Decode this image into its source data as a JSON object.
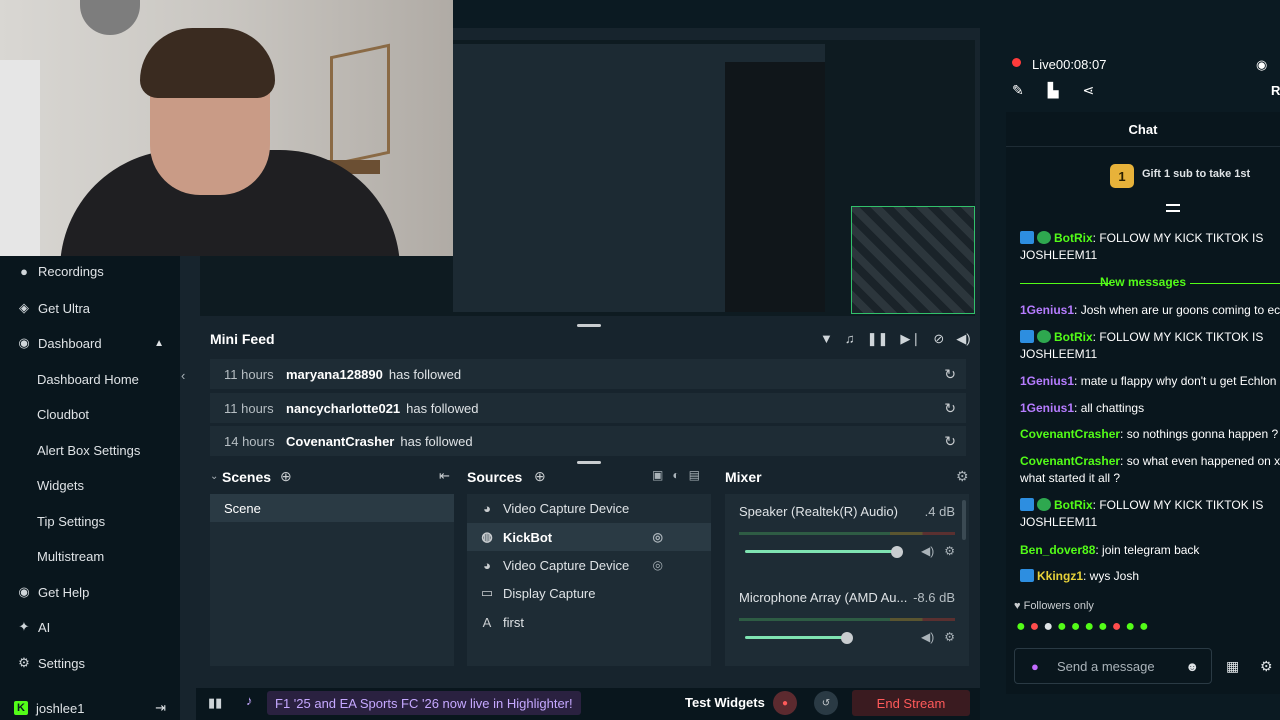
{
  "live": {
    "label": "Live",
    "timer": "00:08:07",
    "viewers_initial": "R"
  },
  "sidebar": {
    "items": [
      {
        "label": "Recordings",
        "icon": "recordings-icon",
        "glyph": "●"
      },
      {
        "label": "Get Ultra",
        "icon": "ultra-icon",
        "glyph": "◈"
      },
      {
        "label": "Dashboard",
        "icon": "dashboard-icon",
        "glyph": "◉"
      },
      {
        "label": "Dashboard Home"
      },
      {
        "label": "Cloudbot"
      },
      {
        "label": "Alert Box Settings"
      },
      {
        "label": "Widgets"
      },
      {
        "label": "Tip Settings"
      },
      {
        "label": "Multistream"
      },
      {
        "label": "Get Help",
        "icon": "help-icon",
        "glyph": "◉"
      },
      {
        "label": "AI",
        "icon": "ai-icon",
        "glyph": "✦"
      },
      {
        "label": "Settings",
        "icon": "gear-icon",
        "glyph": "⚙"
      }
    ],
    "user": "joshlee1"
  },
  "minifeed": {
    "title": "Mini Feed",
    "rows": [
      {
        "time": "11 hours",
        "name": "maryana128890",
        "action": "has followed"
      },
      {
        "time": "11 hours",
        "name": "nancycharlotte021",
        "action": "has followed"
      },
      {
        "time": "14 hours",
        "name": "CovenantCrasher",
        "action": "has followed"
      }
    ]
  },
  "scenes": {
    "title": "Scenes",
    "items": [
      "Scene"
    ]
  },
  "sources": {
    "title": "Sources",
    "items": [
      {
        "label": "Video Capture Device",
        "icon": "camera-icon",
        "glyph": "◕"
      },
      {
        "label": "KickBot",
        "icon": "globe-icon",
        "glyph": "◍"
      },
      {
        "label": "Video Capture Device",
        "icon": "camera-icon",
        "glyph": "◕"
      },
      {
        "label": "Display Capture",
        "icon": "monitor-icon",
        "glyph": "▭"
      },
      {
        "label": "first",
        "icon": "text-icon",
        "glyph": "A"
      }
    ]
  },
  "mixer": {
    "title": "Mixer",
    "channels": [
      {
        "name": "Speaker (Realtek(R) Audio)",
        "db": ".4 dB",
        "level": 0.95
      },
      {
        "name": "Microphone Array (AMD Au...",
        "db": "-8.6 dB",
        "level": 0.64
      }
    ]
  },
  "bottom": {
    "promo": "F1 '25 and EA Sports FC '26 now live in Highlighter!",
    "test_widgets": "Test Widgets",
    "end_stream": "End Stream"
  },
  "chat": {
    "title": "Chat",
    "gift_rank": "1",
    "gift_text": "Gift 1 sub to take 1st",
    "new_messages": "New messages",
    "messages": [
      {
        "user": "BotRix",
        "color": "#53fc18",
        "text": ": FOLLOW MY KICK TIKTOK IS JOSHLEEM11"
      },
      {
        "user": "1Genius1",
        "color": "#b67cff",
        "text": ": Josh when are ur goons coming to ec"
      },
      {
        "user": "BotRix",
        "color": "#53fc18",
        "text": ": FOLLOW MY KICK TIKTOK IS JOSHLEEM11"
      },
      {
        "user": "1Genius1",
        "color": "#b67cff",
        "text": ": mate u flappy why don't u get Echlon"
      },
      {
        "user": "1Genius1",
        "color": "#b67cff",
        "text": ": all chattings"
      },
      {
        "user": "CovenantCrasher",
        "color": "#53fc18",
        "text": ": so nothings gonna happen ?"
      },
      {
        "user": "CovenantCrasher",
        "color": "#53fc18",
        "text": ": so what even happened on x what started it all ?"
      },
      {
        "user": "BotRix",
        "color": "#53fc18",
        "text": ": FOLLOW MY KICK TIKTOK IS JOSHLEEM11"
      },
      {
        "user": "Ben_dover88",
        "color": "#53fc18",
        "text": ": join telegram back"
      },
      {
        "user": "Kkingz1",
        "color": "#e7d23a",
        "text": ": wys Josh"
      }
    ],
    "followers_only": "Followers only",
    "input_placeholder": "Send a message"
  },
  "colors": {
    "accent": "#53fc18",
    "end_stream": "#ff5a5a",
    "promo": "#c5a8ff"
  }
}
